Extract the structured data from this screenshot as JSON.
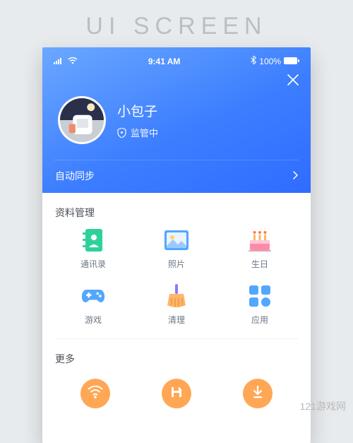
{
  "outer_title": "UI SCREEN",
  "status_bar": {
    "time": "9:41 AM",
    "battery": "100%"
  },
  "profile": {
    "name": "小包子",
    "status": "监管中"
  },
  "sync_label": "自动同步",
  "sections": {
    "data_mgmt": {
      "title": "资料管理",
      "items": [
        {
          "label": "通讯录"
        },
        {
          "label": "照片"
        },
        {
          "label": "生日"
        },
        {
          "label": "游戏"
        },
        {
          "label": "清理"
        },
        {
          "label": "应用"
        }
      ]
    },
    "more": {
      "title": "更多"
    }
  },
  "watermark": "121游戏网",
  "colors": {
    "accent_blue": "#2f6cff",
    "icon_green": "#2fd19a",
    "icon_orange": "#ffa755",
    "icon_pink": "#ff8aa6",
    "icon_blue": "#52a7ff",
    "icon_purple": "#8a7aff"
  }
}
